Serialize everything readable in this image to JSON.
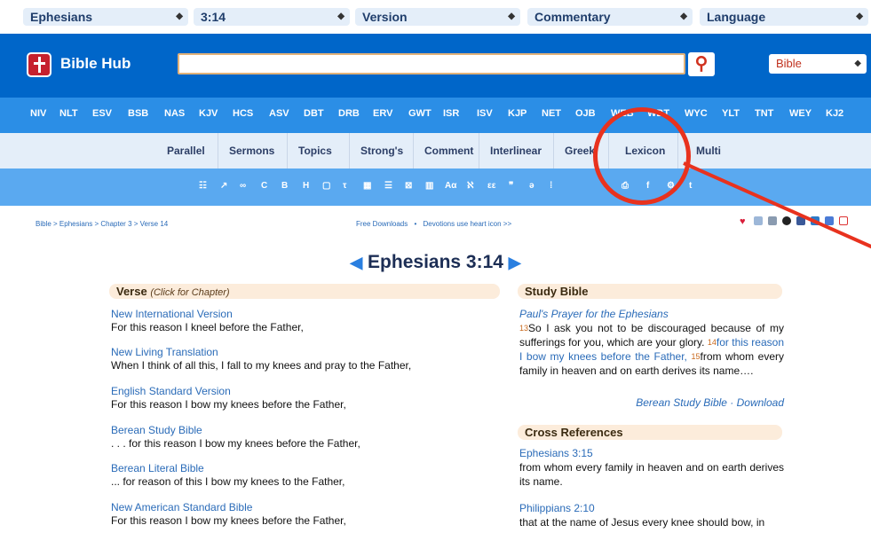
{
  "selectors": {
    "book": "Ephesians",
    "chapter_verse": "3:14",
    "version": "Version",
    "commentary": "Commentary",
    "language": "Language"
  },
  "header": {
    "brand": "Bible Hub",
    "search_placeholder": "",
    "bible_select": "Bible"
  },
  "versions": [
    "NIV",
    "NLT",
    "ESV",
    "BSB",
    "NAS",
    "KJV",
    "HCS",
    "ASV",
    "DBT",
    "DRB",
    "ERV",
    "GWT",
    "ISR",
    "ISV",
    "KJP",
    "NET",
    "OJB",
    "WEB",
    "WBT",
    "WYC",
    "YLT",
    "TNT",
    "WEY",
    "KJ2"
  ],
  "tabs": [
    "Parallel",
    "Sermons",
    "Topics",
    "Strong's",
    "Comment",
    "Interlinear",
    "Greek",
    "Lexicon",
    "Multi"
  ],
  "tools": [
    "☷",
    "↗",
    "∞",
    "C",
    "B",
    "H",
    "▢",
    "τ",
    "▦",
    "☰",
    "⊠",
    "▥",
    "Aα",
    "ℵ",
    "εε",
    "❞",
    "ǝ",
    "⁞",
    "⎙",
    "f",
    "⚙",
    "t"
  ],
  "breadcrumb": "Bible > Ephesians > Chapter 3 > Verse 14",
  "downloads": {
    "free": "Free Downloads",
    "bullet": "•",
    "devotions": "Devotions use heart icon >>"
  },
  "page_title": "Ephesians 3:14",
  "left": {
    "heading": "Verse",
    "heading_sub": "(Click for Chapter)",
    "entries": [
      {
        "name": "New International Version",
        "text": "For this reason I kneel before the Father,"
      },
      {
        "name": "New Living Translation",
        "text": "When I think of all this, I fall to my knees and pray to the Father,"
      },
      {
        "name": "English Standard Version",
        "text": "For this reason I bow my knees before the Father,"
      },
      {
        "name": "Berean Study Bible",
        "text": ". . . for this reason I bow my knees before the Father,"
      },
      {
        "name": "Berean Literal Bible",
        "text": "... for reason of this I bow my knees to the Father,"
      },
      {
        "name": "New American Standard Bible",
        "text": "For this reason I bow my knees before the Father,"
      }
    ]
  },
  "study": {
    "heading": "Study Bible",
    "subtitle": "Paul's Prayer for the Ephesians",
    "v13": "13",
    "t13": "So I ask you not to be discouraged because of my sufferings for you, which are your glory.",
    "v14": "14",
    "t14": "for this reason I bow my knees before the Father,",
    "v15": "15",
    "t15": "from whom every family in heaven and on earth derives its name….",
    "credit": "Berean Study Bible · Download"
  },
  "xref": {
    "heading": "Cross References",
    "r1": "Ephesians 3:15",
    "t1": "from whom every family in heaven and on earth derives its name.",
    "r2": "Philippians 2:10",
    "t2": "that at the name of Jesus every knee should bow, in"
  },
  "colors": {
    "header": "#0066c9",
    "annotation": "#e8321e"
  }
}
